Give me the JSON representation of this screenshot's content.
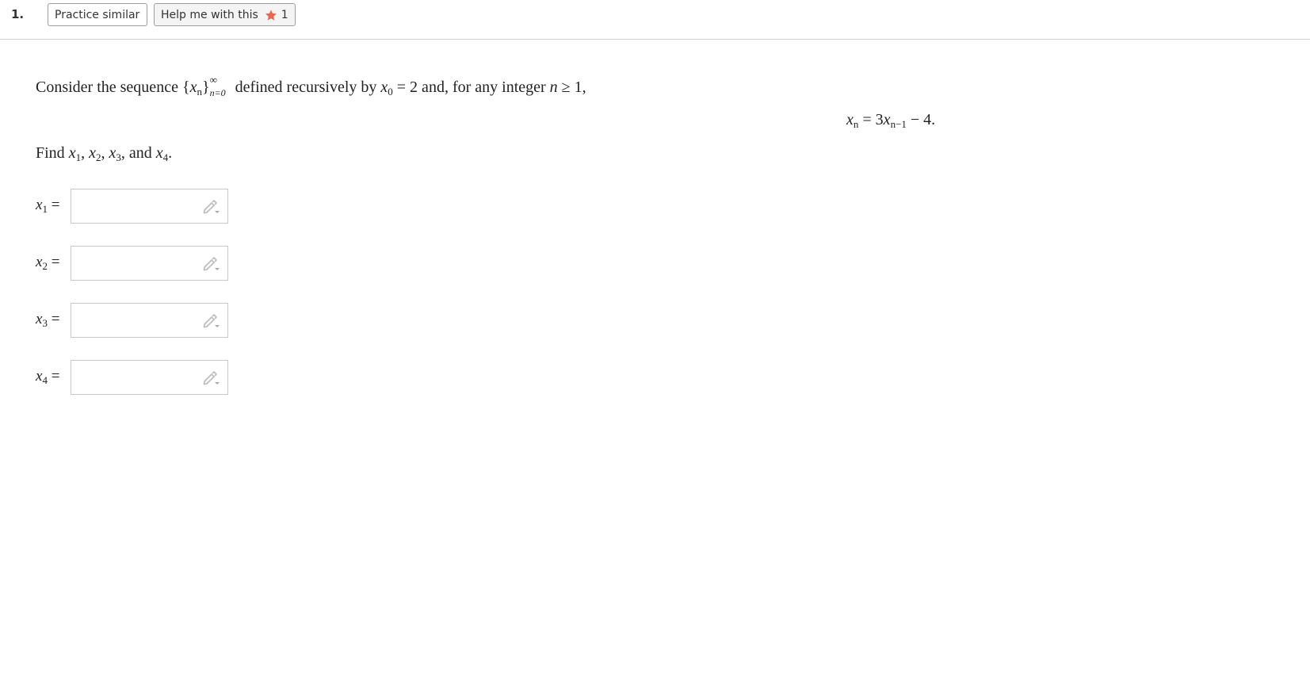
{
  "toolbar": {
    "question_number": "1.",
    "practice_label": "Practice similar",
    "help_label": "Help me with this",
    "help_count": "1",
    "star_icon": "star-icon",
    "star_color": "#e8674e"
  },
  "problem": {
    "intro_prefix": "Consider the sequence",
    "seq_open": "{",
    "seq_var": "x",
    "seq_sub": "n",
    "seq_close": "}",
    "seq_upper": "∞",
    "seq_lower": "n=0",
    "intro_mid": "defined recursively by",
    "init_var": "x",
    "init_sub": "0",
    "init_rest": "= 2 and, for any integer",
    "int_var": "n",
    "int_rest": "≥ 1,",
    "recur_lhs": "x",
    "recur_lhs_sub": "n",
    "recur_eq": "= 3",
    "recur_var": "x",
    "recur_var_sub": "n−1",
    "recur_tail": "− 4.",
    "find_prefix": "Find",
    "find_items": [
      {
        "var": "x",
        "sub": "1",
        "sep": ","
      },
      {
        "var": "x",
        "sub": "2",
        "sep": ","
      },
      {
        "var": "x",
        "sub": "3",
        "sep": ", and"
      },
      {
        "var": "x",
        "sub": "4",
        "sep": "."
      }
    ]
  },
  "answers": [
    {
      "var": "x",
      "sub": "1",
      "eq": "=",
      "value": ""
    },
    {
      "var": "x",
      "sub": "2",
      "eq": "=",
      "value": ""
    },
    {
      "var": "x",
      "sub": "3",
      "eq": "=",
      "value": ""
    },
    {
      "var": "x",
      "sub": "4",
      "eq": "=",
      "value": ""
    }
  ],
  "edit_icon": "pencil-dropdown-icon"
}
